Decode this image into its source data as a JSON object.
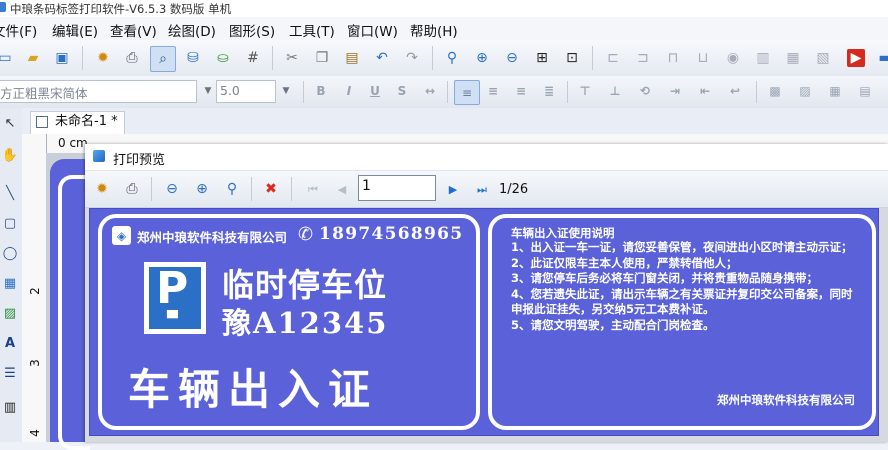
{
  "window": {
    "title": "中琅条码标签打印软件-V6.5.3 数码版 单机"
  },
  "menu": [
    "文件(F)",
    "编辑(E)",
    "查看(V)",
    "绘图(D)",
    "图形(S)",
    "工具(T)",
    "窗口(W)",
    "帮助(H)"
  ],
  "format_toolbar": {
    "font_name": "方正粗黑宋简体",
    "font_size": "5.0"
  },
  "document": {
    "tab_label": "未命名-1 *"
  },
  "ruler": {
    "unit_label": "0 cm",
    "v_ticks": [
      "2",
      "3",
      "4"
    ]
  },
  "preview": {
    "title": "打印预览",
    "page_input": "1",
    "page_count": "1/26"
  },
  "label": {
    "company": "郑州中琅软件科技有限公司",
    "phone": "18974568965",
    "parking_title": "临时停车位",
    "plate": "豫A12345",
    "pass_title": "车辆出入证",
    "notes_title": "车辆出入证使用说明",
    "notes": [
      "1、出入证一车一证，请您妥善保管，夜间进出小区时请主动示证；",
      "2、此证仅限车主本人使用，严禁转借他人；",
      "3、请您停车后务必将车门窗关闭，并将贵重物品随身携带；",
      "4、您若遗失此证，请出示车辆之有关票证并复印交公司备案，同时申报此证挂失，另交纳5元工本费补证。",
      "5、请您文明驾驶，主动配合门岗检查。"
    ],
    "notes_company": "郑州中琅软件科技有限公司",
    "colors": {
      "background": "#5b62d9",
      "text": "#ffffff"
    }
  }
}
